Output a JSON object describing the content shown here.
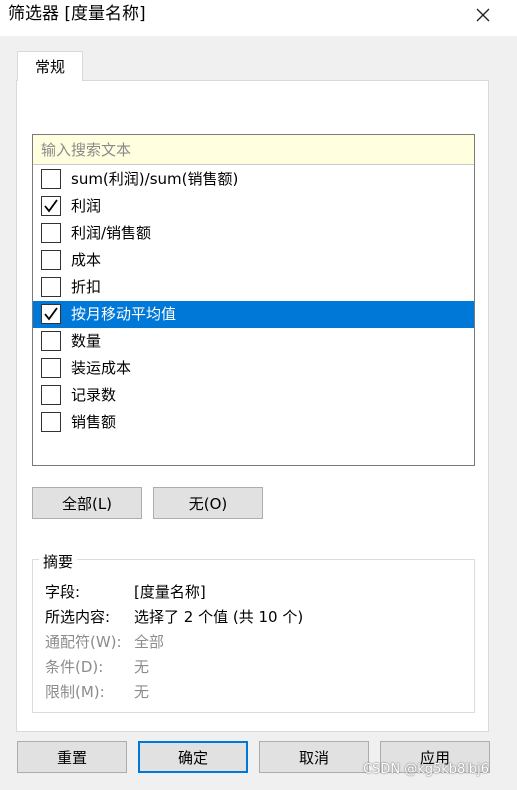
{
  "window": {
    "title": "筛选器 [度量名称]",
    "close_glyph": "✕"
  },
  "tabs": [
    {
      "label": "常规"
    }
  ],
  "search": {
    "placeholder": "输入搜索文本"
  },
  "items": [
    {
      "label": "sum(利润)/sum(销售额)",
      "checked": false,
      "selected": false
    },
    {
      "label": "利润",
      "checked": true,
      "selected": false
    },
    {
      "label": "利润/销售额",
      "checked": false,
      "selected": false
    },
    {
      "label": "成本",
      "checked": false,
      "selected": false
    },
    {
      "label": "折扣",
      "checked": false,
      "selected": false
    },
    {
      "label": "按月移动平均值",
      "checked": true,
      "selected": true
    },
    {
      "label": "数量",
      "checked": false,
      "selected": false
    },
    {
      "label": "装运成本",
      "checked": false,
      "selected": false
    },
    {
      "label": "记录数",
      "checked": false,
      "selected": false
    },
    {
      "label": "销售额",
      "checked": false,
      "selected": false
    }
  ],
  "list_buttons": {
    "all_label": "全部(L)",
    "none_label": "无(O)"
  },
  "summary": {
    "legend": "摘要",
    "rows": [
      {
        "key": "字段:",
        "value": "[度量名称]",
        "enabled": true
      },
      {
        "key": "所选内容:",
        "value": "选择了 2 个值 (共 10 个)",
        "enabled": true
      },
      {
        "key": "通配符(W):",
        "value": "全部",
        "enabled": false
      },
      {
        "key": "条件(D):",
        "value": "无",
        "enabled": false
      },
      {
        "key": "限制(M):",
        "value": "无",
        "enabled": false
      }
    ]
  },
  "footer": {
    "reset_label": "重置",
    "ok_label": "确定",
    "cancel_label": "取消",
    "apply_label": "应用"
  },
  "watermark": "CSDN @kg5kb8lbj6",
  "colors": {
    "selection": "#0078d7",
    "search_bg": "#ffffe0",
    "dialog_bg": "#f0f0f0"
  }
}
